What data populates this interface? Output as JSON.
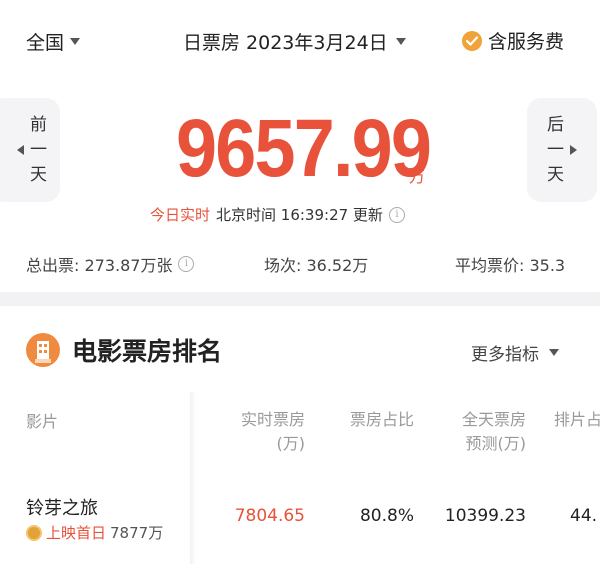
{
  "header": {
    "region": "全国",
    "date_label": "日票房 2023年3月24日",
    "service_fee": "含服务费"
  },
  "nav": {
    "prev": [
      "前",
      "一",
      "天"
    ],
    "next": [
      "后",
      "一",
      "天"
    ]
  },
  "summary": {
    "total_box_office": "9657.99",
    "unit": "万",
    "realtime_label": "今日实时",
    "update_text": "北京时间 16:39:27 更新",
    "stats": [
      {
        "label": "总出票: 273.87万张"
      },
      {
        "label": "场次: 36.52万"
      },
      {
        "label": "平均票价: 35.3"
      }
    ]
  },
  "ranking": {
    "title": "电影票房排名",
    "more_metrics": "更多指标",
    "columns": {
      "film": "影片",
      "realtime": [
        "实时票房",
        "(万)"
      ],
      "share": "票房占比",
      "forecast": [
        "全天票房",
        "预测(万)"
      ],
      "schedule": "排片占"
    },
    "rows": [
      {
        "name": "铃芽之旅",
        "badge": "上映首日",
        "cumulative": "7877万",
        "realtime": "7804.65",
        "share": "80.8%",
        "forecast": "10399.23",
        "schedule": "44."
      }
    ]
  },
  "colors": {
    "accent": "#e8523a",
    "check": "#f0a23b"
  }
}
